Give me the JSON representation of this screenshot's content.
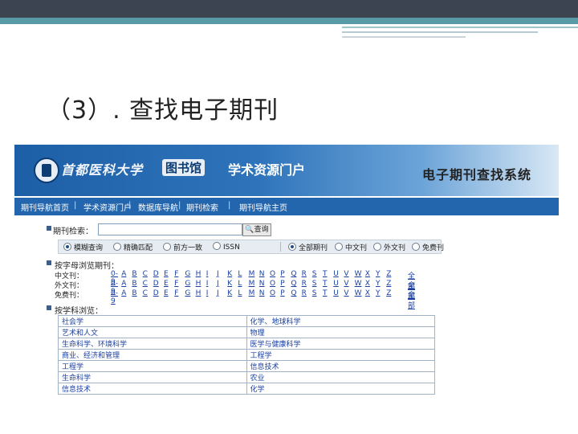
{
  "slide": {
    "title": "（3）. 查找电子期刊"
  },
  "portal": {
    "university": "首都医科大学",
    "library": "图书馆",
    "portal_name": "学术资源门户",
    "system_name": "电子期刊查找系统"
  },
  "nav": {
    "items": [
      "期刊导航首页",
      "学术资源门户",
      "数据库导航",
      "期刊检索",
      "期刊导航主页"
    ]
  },
  "search": {
    "label": "期刊检索：",
    "value": "",
    "button_label": "查询"
  },
  "options": {
    "match": [
      {
        "label": "模糊查询",
        "selected": true
      },
      {
        "label": "精确匹配",
        "selected": false
      },
      {
        "label": "前方一致",
        "selected": false
      },
      {
        "label": "ISSN",
        "selected": false
      }
    ],
    "language": [
      {
        "label": "全部期刊",
        "selected": true
      },
      {
        "label": "中文刊",
        "selected": false
      },
      {
        "label": "外文刊",
        "selected": false
      },
      {
        "label": "免费刊",
        "selected": false
      }
    ]
  },
  "alpha_section": {
    "title": "按字母浏览期刊：",
    "rows": [
      {
        "label": "中文刊：",
        "all": "全部"
      },
      {
        "label": "外文刊：",
        "all": "全部"
      },
      {
        "label": "免费刊：",
        "all": "全部"
      }
    ],
    "letters": [
      "0-9",
      "A",
      "B",
      "C",
      "D",
      "E",
      "F",
      "G",
      "H",
      "I",
      "J",
      "K",
      "L",
      "M",
      "N",
      "O",
      "P",
      "Q",
      "R",
      "S",
      "T",
      "U",
      "V",
      "W",
      "X",
      "Y",
      "Z"
    ]
  },
  "subject_section": {
    "title": "按学科浏览：",
    "rows": [
      [
        "社会学",
        "化学、地球科学"
      ],
      [
        "艺术和人文",
        "物理"
      ],
      [
        "生命科学、环境科学",
        "医学与健康科学"
      ],
      [
        "商业、经济和管理",
        "工程学"
      ],
      [
        "工程学",
        "信息技术"
      ],
      [
        "生命科学",
        "农业"
      ],
      [
        "信息技术",
        "化学"
      ]
    ]
  }
}
